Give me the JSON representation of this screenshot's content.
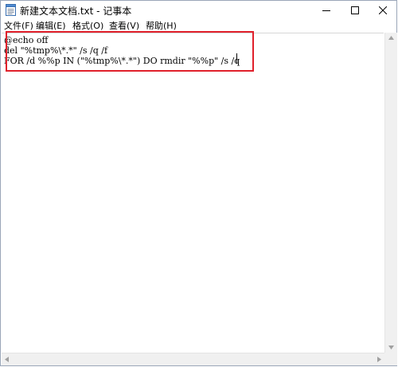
{
  "window": {
    "title": "新建文本文档.txt - 记事本"
  },
  "menu": [
    {
      "label": "文件(F)"
    },
    {
      "label": "编辑(E)"
    },
    {
      "label": "格式(O)"
    },
    {
      "label": "查看(V)"
    },
    {
      "label": "帮助(H)"
    }
  ],
  "editor": {
    "lines": [
      "@echo off",
      "del \"%tmp%\\*.*\" /s /q /f",
      "FOR /d %%p IN (\"%tmp%\\*.*\") DO rmdir \"%%p\" /s /q"
    ]
  },
  "colors": {
    "highlight_box": "#e0202b",
    "scrollbar": "#f0f0f0"
  }
}
